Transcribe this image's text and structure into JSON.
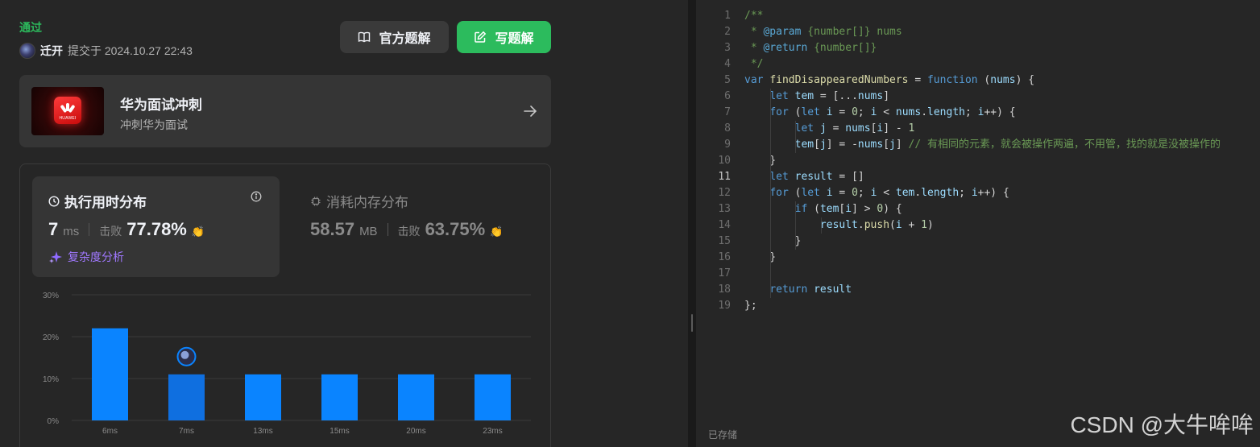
{
  "submission": {
    "status": "通过",
    "user_name": "迁开",
    "submitted_at": "提交于 2024.10.27 22:43"
  },
  "buttons": {
    "official_solution": "官方题解",
    "write_solution": "写题解"
  },
  "promo": {
    "thumb_brand": "HUAWEI",
    "title": "华为面试冲刺",
    "subtitle": "冲刺华为面试"
  },
  "runtime": {
    "title": "执行用时分布",
    "value": "7",
    "unit": "ms",
    "beat_label": "击败",
    "beat_percent": "77.78%",
    "complexity_link": "复杂度分析"
  },
  "memory": {
    "title": "消耗内存分布",
    "value": "58.57",
    "unit": "MB",
    "beat_label": "击败",
    "beat_percent": "63.75%"
  },
  "colors": {
    "accent_green": "#2cbb5d",
    "bar_blue": "#0a84ff",
    "bar_highlight": "#0f6fe0",
    "complexity_purple": "#a078ff"
  },
  "chart_data": {
    "type": "bar",
    "categories": [
      "6ms",
      "7ms",
      "13ms",
      "15ms",
      "20ms",
      "23ms"
    ],
    "values": [
      22,
      11,
      11,
      11,
      11,
      11
    ],
    "y_ticks": [
      "0%",
      "10%",
      "20%",
      "30%"
    ],
    "ylim": [
      0,
      30
    ],
    "highlight_category": "7ms",
    "grid": true
  },
  "editor": {
    "lines": [
      [
        [
          "/**",
          "cm"
        ]
      ],
      [
        [
          " * ",
          "cm"
        ],
        [
          "@param",
          "tag"
        ],
        [
          " {number[]} nums",
          "cm"
        ]
      ],
      [
        [
          " * ",
          "cm"
        ],
        [
          "@return",
          "tag"
        ],
        [
          " {number[]}",
          "cm"
        ]
      ],
      [
        [
          " */",
          "cm"
        ]
      ],
      [
        [
          "var",
          "kw"
        ],
        [
          " ",
          "pl"
        ],
        [
          "findDisappearedNumbers",
          "fn"
        ],
        [
          " = ",
          "pl"
        ],
        [
          "function",
          "kw"
        ],
        [
          " (",
          "pl"
        ],
        [
          "nums",
          "var"
        ],
        [
          ") {",
          "pl"
        ]
      ],
      [
        [
          "    ",
          "pl"
        ],
        [
          "let",
          "kw"
        ],
        [
          " ",
          "pl"
        ],
        [
          "tem",
          "var"
        ],
        [
          " = [...",
          "pl"
        ],
        [
          "nums",
          "var"
        ],
        [
          "]",
          "pl"
        ]
      ],
      [
        [
          "    ",
          "pl"
        ],
        [
          "for",
          "kw"
        ],
        [
          " (",
          "pl"
        ],
        [
          "let",
          "kw"
        ],
        [
          " ",
          "pl"
        ],
        [
          "i",
          "var"
        ],
        [
          " = ",
          "pl"
        ],
        [
          "0",
          "num"
        ],
        [
          "; ",
          "pl"
        ],
        [
          "i",
          "var"
        ],
        [
          " < ",
          "pl"
        ],
        [
          "nums",
          "var"
        ],
        [
          ".",
          "pl"
        ],
        [
          "length",
          "var"
        ],
        [
          "; ",
          "pl"
        ],
        [
          "i",
          "var"
        ],
        [
          "++) {",
          "pl"
        ]
      ],
      [
        [
          "        ",
          "pl"
        ],
        [
          "let",
          "kw"
        ],
        [
          " ",
          "pl"
        ],
        [
          "j",
          "var"
        ],
        [
          " = ",
          "pl"
        ],
        [
          "nums",
          "var"
        ],
        [
          "[",
          "pl"
        ],
        [
          "i",
          "var"
        ],
        [
          "] - ",
          "pl"
        ],
        [
          "1",
          "num"
        ]
      ],
      [
        [
          "        ",
          "pl"
        ],
        [
          "tem",
          "var"
        ],
        [
          "[",
          "pl"
        ],
        [
          "j",
          "var"
        ],
        [
          "] = -",
          "pl"
        ],
        [
          "nums",
          "var"
        ],
        [
          "[",
          "pl"
        ],
        [
          "j",
          "var"
        ],
        [
          "] ",
          "pl"
        ],
        [
          "// 有相同的元素，就会被操作两遍，不用管，找的就是没被操作的",
          "cm"
        ]
      ],
      [
        [
          "    }",
          "pl"
        ]
      ],
      [
        [
          "    ",
          "pl"
        ],
        [
          "let",
          "kw"
        ],
        [
          " ",
          "pl"
        ],
        [
          "result",
          "var"
        ],
        [
          " = []",
          "pl"
        ]
      ],
      [
        [
          "    ",
          "pl"
        ],
        [
          "for",
          "kw"
        ],
        [
          " (",
          "pl"
        ],
        [
          "let",
          "kw"
        ],
        [
          " ",
          "pl"
        ],
        [
          "i",
          "var"
        ],
        [
          " = ",
          "pl"
        ],
        [
          "0",
          "num"
        ],
        [
          "; ",
          "pl"
        ],
        [
          "i",
          "var"
        ],
        [
          " < ",
          "pl"
        ],
        [
          "tem",
          "var"
        ],
        [
          ".",
          "pl"
        ],
        [
          "length",
          "var"
        ],
        [
          "; ",
          "pl"
        ],
        [
          "i",
          "var"
        ],
        [
          "++) {",
          "pl"
        ]
      ],
      [
        [
          "        ",
          "pl"
        ],
        [
          "if",
          "kw"
        ],
        [
          " (",
          "pl"
        ],
        [
          "tem",
          "var"
        ],
        [
          "[",
          "pl"
        ],
        [
          "i",
          "var"
        ],
        [
          "] > ",
          "pl"
        ],
        [
          "0",
          "num"
        ],
        [
          ") {",
          "pl"
        ]
      ],
      [
        [
          "            ",
          "pl"
        ],
        [
          "result",
          "var"
        ],
        [
          ".",
          "pl"
        ],
        [
          "push",
          "fn"
        ],
        [
          "(",
          "pl"
        ],
        [
          "i",
          "var"
        ],
        [
          " + ",
          "pl"
        ],
        [
          "1",
          "num"
        ],
        [
          ")",
          "pl"
        ]
      ],
      [
        [
          "        }",
          "pl"
        ]
      ],
      [
        [
          "    }",
          "pl"
        ]
      ],
      [
        [
          "",
          "pl"
        ]
      ],
      [
        [
          "    ",
          "pl"
        ],
        [
          "return",
          "kw"
        ],
        [
          " ",
          "pl"
        ],
        [
          "result",
          "var"
        ]
      ],
      [
        [
          "};",
          "pl"
        ]
      ]
    ],
    "active_line": 11,
    "saved_status": "已存储"
  },
  "watermark": "CSDN @大牛哞哞"
}
